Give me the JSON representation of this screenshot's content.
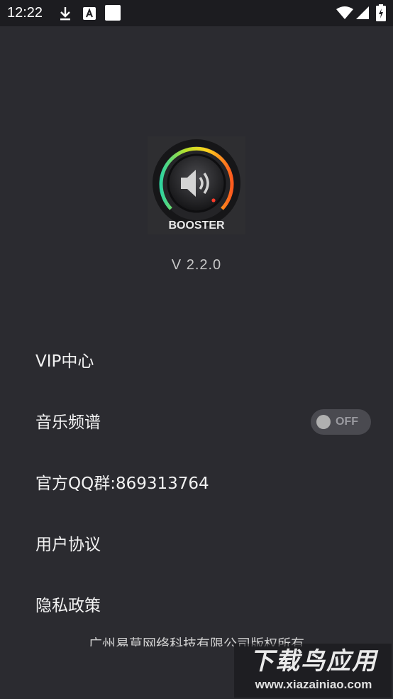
{
  "status_bar": {
    "time": "12:22",
    "icons": [
      "download-icon",
      "a-icon",
      "blank-notification-icon",
      "wifi-icon",
      "signal-icon",
      "battery-icon"
    ]
  },
  "app": {
    "logo_text": "BOOSTER",
    "version": "V 2.2.0"
  },
  "menu": {
    "vip": "VIP中心",
    "spectrum": "音乐频谱",
    "spectrum_toggle": "OFF",
    "qq_group": "官方QQ群:869313764",
    "user_agreement": "用户协议",
    "privacy": "隐私政策"
  },
  "footer": {
    "copyright": "广州易草网络科技有限公司版权所有"
  },
  "watermark": {
    "title": "下载鸟应用",
    "url": "www.xiazainiao.com"
  },
  "colors": {
    "background": "#2b2b30",
    "status_bar": "#1c1c20",
    "toggle_off": "#4a4a50"
  }
}
